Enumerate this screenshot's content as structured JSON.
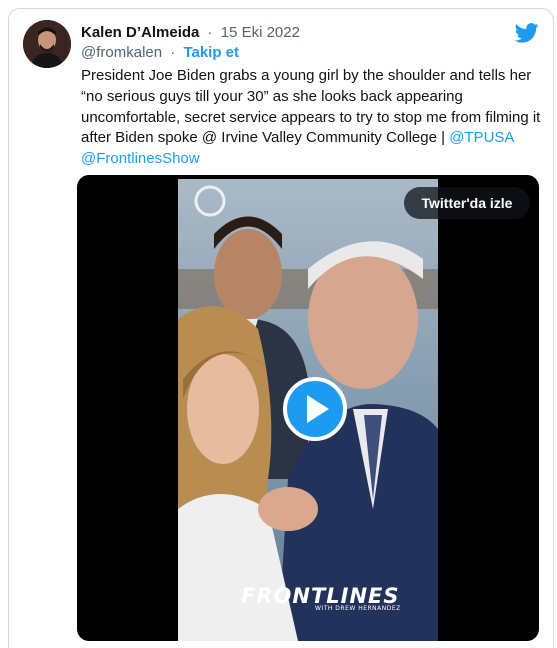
{
  "tweet": {
    "author_name": "Kalen D’Almeida",
    "separator": "·",
    "date": "15 Eki 2022",
    "handle": "@fromkalen",
    "follow_label": "Takip et",
    "text_lines": [
      "President Joe Biden grabs a young girl by the shoulder and tells her",
      "“no serious guys till your 30” as she looks back appearing",
      "uncomfortable, secret service appears to try to stop me from filming it",
      "after Biden spoke @ Irvine Valley Community College | "
    ],
    "mention_tpusa": "@TPUSA",
    "mention_frontlines": "@FrontlinesShow",
    "platform_icon": "twitter-bird-icon",
    "accent_color": "#1d9bf0"
  },
  "video": {
    "watch_label": "Twitter'da izle",
    "play_icon": "play-icon",
    "watermark": "FRONTLINES",
    "watermark_sub": "WITH DREW HERNANDEZ"
  }
}
